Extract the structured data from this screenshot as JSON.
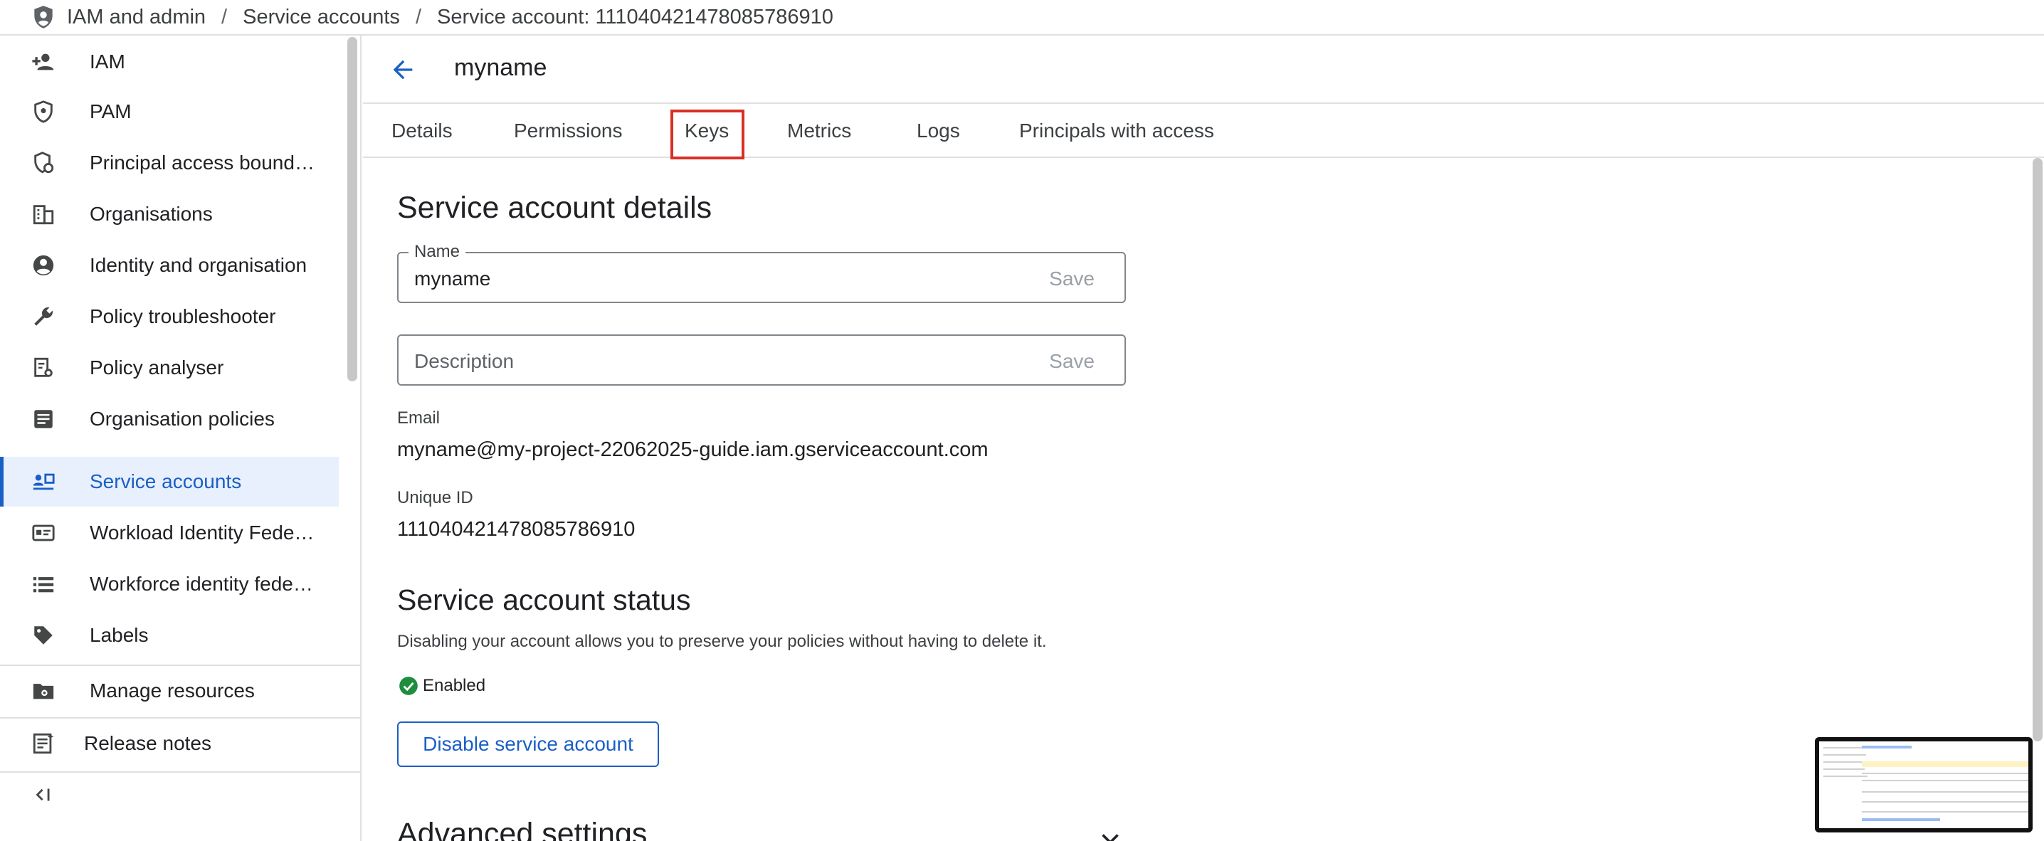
{
  "breadcrumb": {
    "items": [
      "IAM and admin",
      "Service accounts",
      "Service account: 111040421478085786910"
    ],
    "separator": "/"
  },
  "sidebar": {
    "items": [
      {
        "label": "IAM",
        "icon": "person-add-icon"
      },
      {
        "label": "PAM",
        "icon": "shield-lock-icon"
      },
      {
        "label": "Principal access bound…",
        "icon": "shield-settings-icon"
      },
      {
        "label": "Organisations",
        "icon": "building-icon"
      },
      {
        "label": "Identity and organisation",
        "icon": "account-circle-icon"
      },
      {
        "label": "Policy troubleshooter",
        "icon": "wrench-icon"
      },
      {
        "label": "Policy analyser",
        "icon": "document-search-icon"
      },
      {
        "label": "Organisation policies",
        "icon": "list-document-icon"
      },
      {
        "label": "Service accounts",
        "icon": "service-account-icon",
        "active": true
      },
      {
        "label": "Workload Identity Fede…",
        "icon": "id-card-icon"
      },
      {
        "label": "Workforce identity fede…",
        "icon": "list-icon"
      },
      {
        "label": "Labels",
        "icon": "tag-icon"
      }
    ],
    "manage_resources": "Manage resources",
    "release_notes": "Release notes"
  },
  "header": {
    "title": "myname"
  },
  "tabs": [
    "Details",
    "Permissions",
    "Keys",
    "Metrics",
    "Logs",
    "Principals with access"
  ],
  "highlighted_tab": "Keys",
  "details": {
    "heading": "Service account details",
    "name_label": "Name",
    "name_value": "myname",
    "save_label": "Save",
    "description_placeholder": "Description",
    "email_label": "Email",
    "email_value": "myname@my-project-22062025-guide.iam.gserviceaccount.com",
    "unique_id_label": "Unique ID",
    "unique_id_value": "111040421478085786910"
  },
  "status": {
    "heading": "Service account status",
    "helper": "Disabling your account allows you to preserve your policies without having to delete it.",
    "state": "Enabled",
    "disable_button": "Disable service account"
  },
  "advanced": {
    "heading": "Advanced settings"
  },
  "colors": {
    "accent": "#1a5fc6",
    "active_bg": "#e8f0fe",
    "highlight_box": "#d93025",
    "enabled_green": "#1e8e3e"
  }
}
